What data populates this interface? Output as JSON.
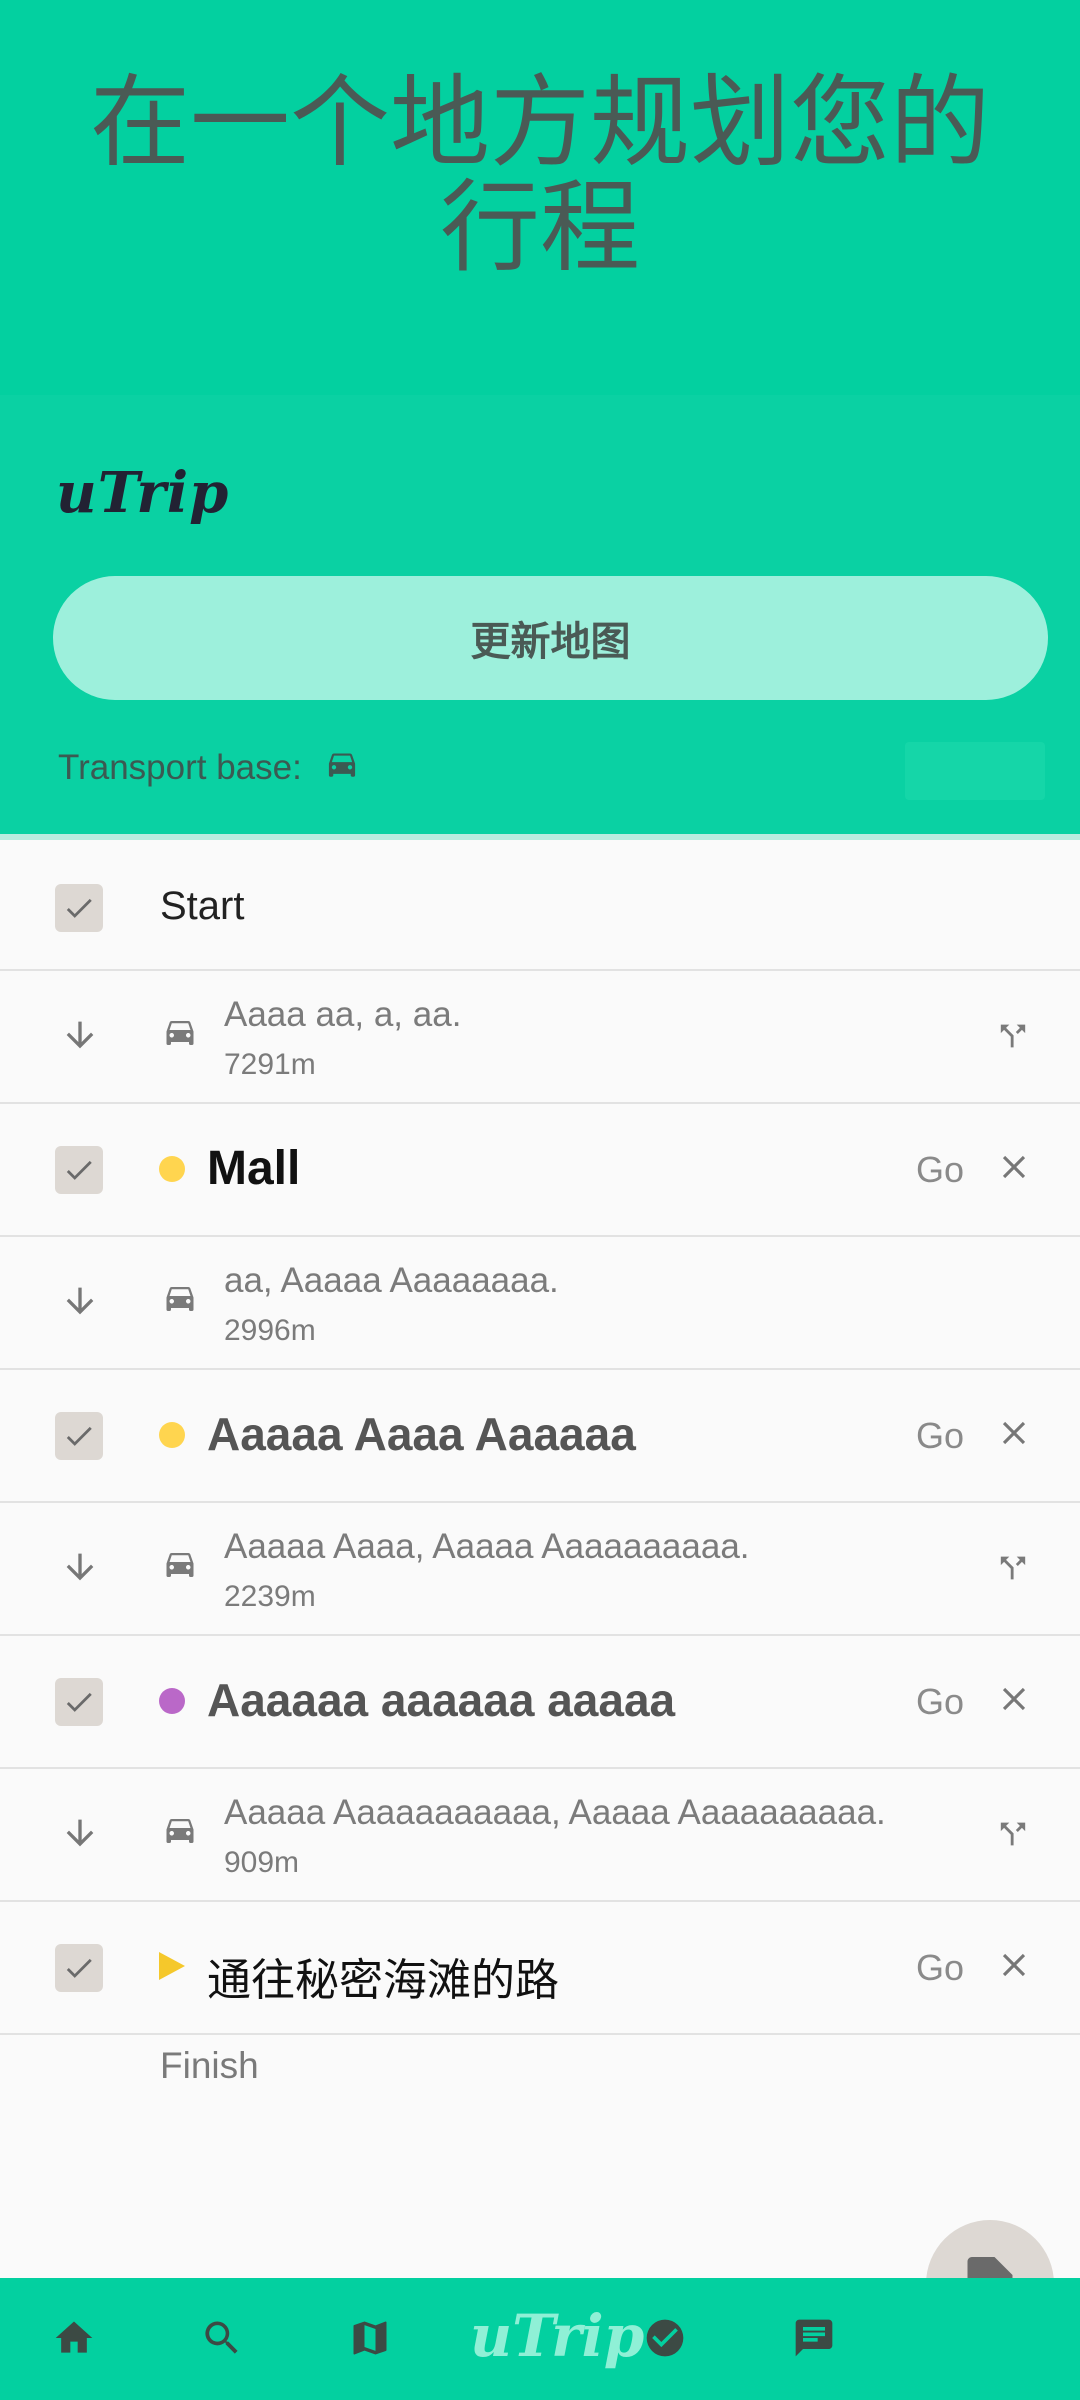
{
  "hero": {
    "title": "在一个地方规划您的行程"
  },
  "panel": {
    "brand": "uTrip",
    "update_button": "更新地图",
    "transport_label": "Transport base:",
    "transport_icon": "car-icon"
  },
  "list": {
    "start": "Start",
    "finish": "Finish",
    "go_label": "Go",
    "stops": [
      {
        "title": "Mall",
        "marker": "dot",
        "color": "#ffd54f",
        "checked": true
      },
      {
        "title": "Aaaaa Aaaa Aaaaaa",
        "marker": "dot",
        "color": "#ffd54f",
        "checked": true
      },
      {
        "title": "Aaaaaa aaaaaa aaaaa",
        "marker": "dot",
        "color": "#ba68c8",
        "checked": true
      },
      {
        "title": "通往秘密海滩的路",
        "marker": "flag",
        "color": "#f5c82b",
        "checked": true
      }
    ],
    "routes": [
      {
        "text": "Aaaa aa, a, aa.",
        "distance": "7291m",
        "has_fork": true
      },
      {
        "text": "aa, Aaaaa Aaaaaaaa.",
        "distance": "2996m",
        "has_fork": false
      },
      {
        "text": "Aaaaa Aaaa, Aaaaa Aaaaaaaaaa.",
        "distance": "2239m",
        "has_fork": true
      },
      {
        "text": "Aaaaa Aaaaaaaaaaa, Aaaaa Aaaaaaaaaa.",
        "distance": "909m",
        "has_fork": true
      }
    ]
  },
  "nav": {
    "items": [
      "home-icon",
      "search-icon",
      "map-icon",
      "uTrip",
      "check-circle-icon",
      "chat-icon"
    ],
    "brand": "uTrip"
  },
  "colors": {
    "primary": "#03d0a0",
    "button": "#9df0dc",
    "fab": "#ddd8d3"
  }
}
